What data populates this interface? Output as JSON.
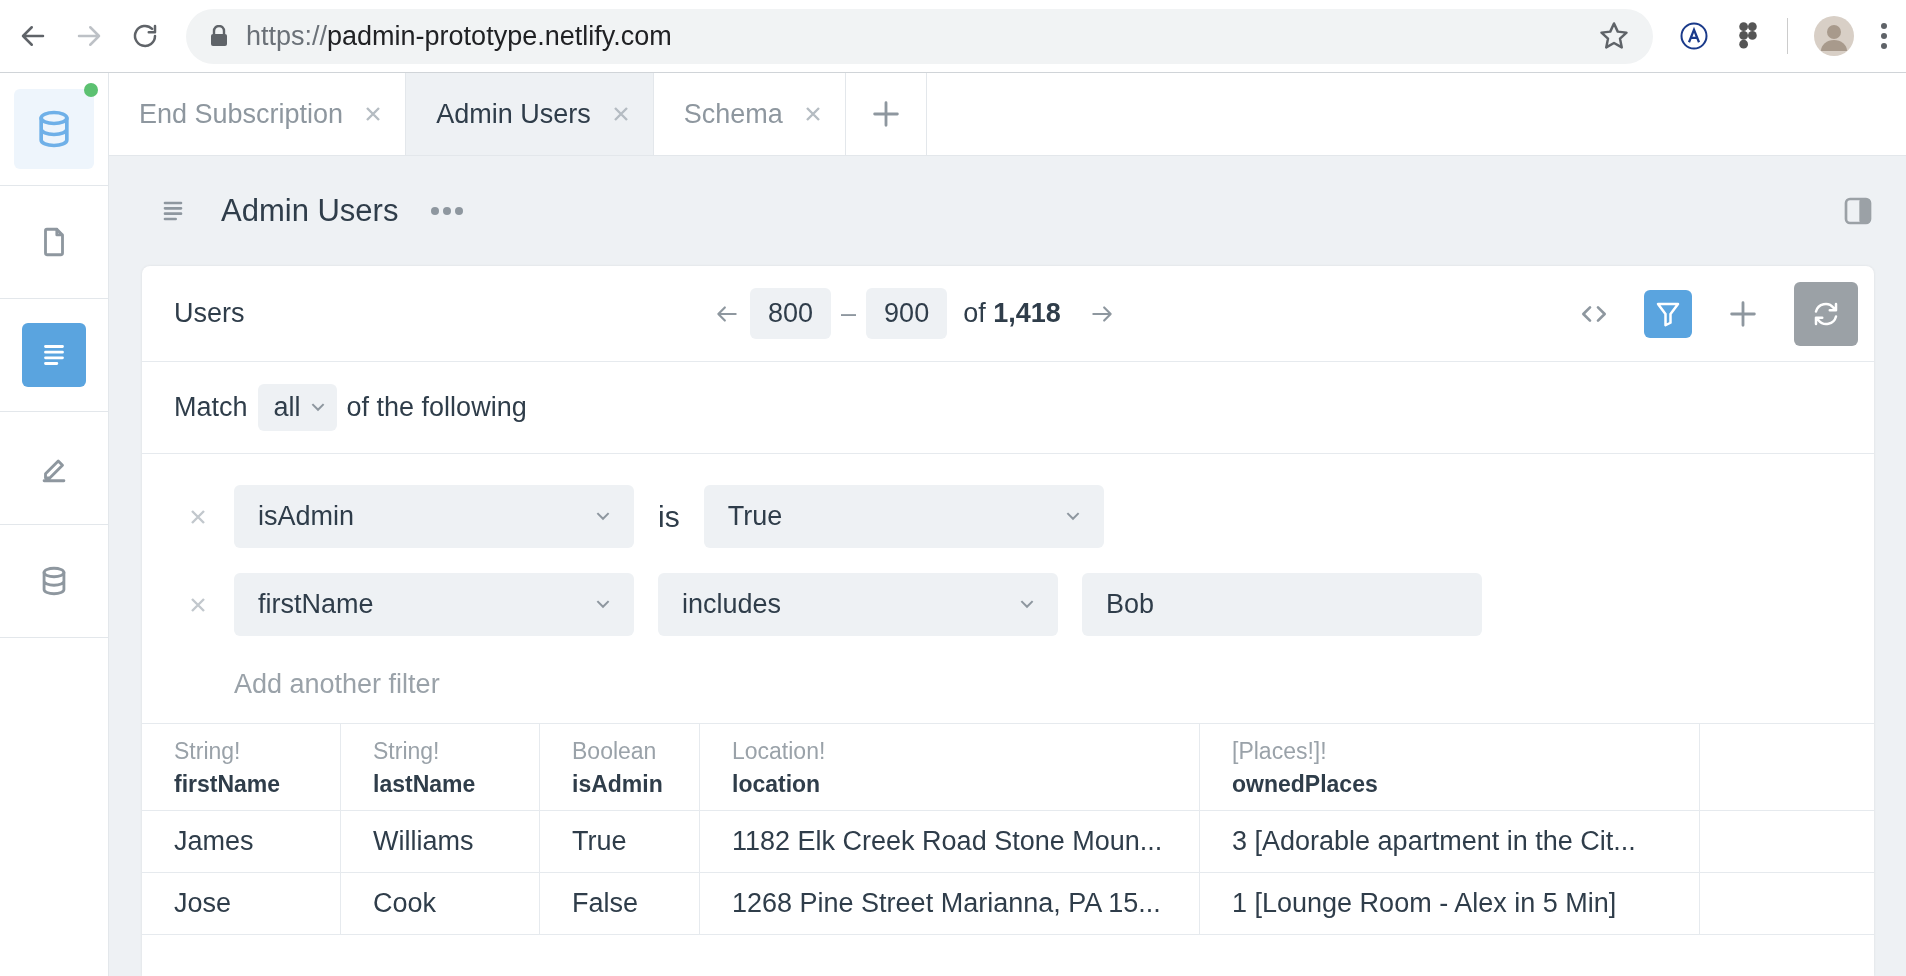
{
  "browser": {
    "url_scheme": "https://",
    "url_host": "padmin-prototype.netlify.com"
  },
  "sidebar": {
    "logo": {
      "online": true
    },
    "items": [
      {
        "kind": "document",
        "selected": false
      },
      {
        "kind": "list",
        "selected": true
      },
      {
        "kind": "edit",
        "selected": false
      },
      {
        "kind": "database",
        "selected": false
      }
    ]
  },
  "tabs": [
    {
      "label": "End Subscription",
      "selected": false
    },
    {
      "label": "Admin Users",
      "selected": true
    },
    {
      "label": "Schema",
      "selected": false
    }
  ],
  "page": {
    "title": "Admin Users"
  },
  "card": {
    "title": "Users",
    "range_start": "800",
    "range_end": "900",
    "range_dash": "–",
    "total": "of **1,418**",
    "filter_active": true
  },
  "match": {
    "label": "Match",
    "mode": "all",
    "suffix": "of the following"
  },
  "filters": [
    {
      "kind": "boolean",
      "field": "isAdmin",
      "operator": "is",
      "value": "True"
    },
    {
      "kind": "text",
      "field": "firstName",
      "operator": "includes",
      "value": "Bob"
    }
  ],
  "add_filter": "Add another filter",
  "table": {
    "columns": [
      {
        "type": "String!",
        "name": "firstName"
      },
      {
        "type": "String!",
        "name": "lastName"
      },
      {
        "type": "Boolean",
        "name": "isAdmin"
      },
      {
        "type": "Location!",
        "name": "location"
      },
      {
        "type": "[Places!]!",
        "name": "ownedPlaces"
      }
    ],
    "rows": [
      [
        "James",
        "Williams",
        "True",
        "1182 Elk Creek Road Stone Moun...",
        "3 [Adorable apartment in the Cit..."
      ],
      [
        "Jose",
        "Cook",
        "False",
        "1268 Pine Street Marianna, PA 15...",
        "1 [Lounge Room - Alex in 5 Min]"
      ]
    ]
  }
}
